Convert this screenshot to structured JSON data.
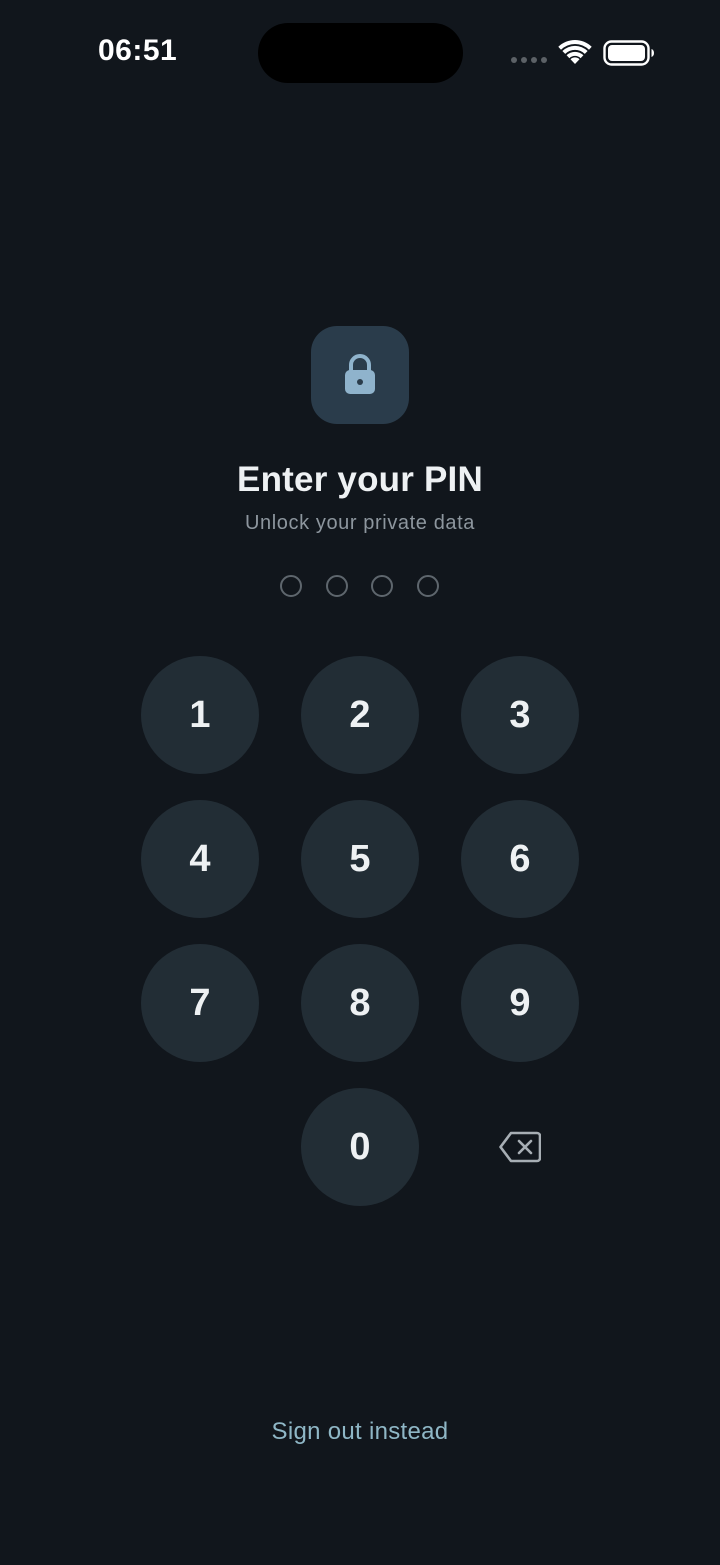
{
  "status_bar": {
    "time": "06:51",
    "icons": [
      "signal-dots-icon",
      "wifi-icon",
      "battery-icon"
    ]
  },
  "lock_screen": {
    "icon": "lock-icon",
    "title": "Enter your PIN",
    "subtitle": "Unlock your private data",
    "pin_length": 4,
    "digits_entered": 0
  },
  "keypad": {
    "keys": [
      "1",
      "2",
      "3",
      "4",
      "5",
      "6",
      "7",
      "8",
      "9",
      "0"
    ],
    "backspace_icon": "backspace-icon"
  },
  "footer": {
    "sign_out_label": "Sign out instead"
  },
  "colors": {
    "background": "#11161c",
    "key_fill": "#222d35",
    "lock_tile": "#2a3c4b",
    "accent": "#8fb7c6"
  }
}
